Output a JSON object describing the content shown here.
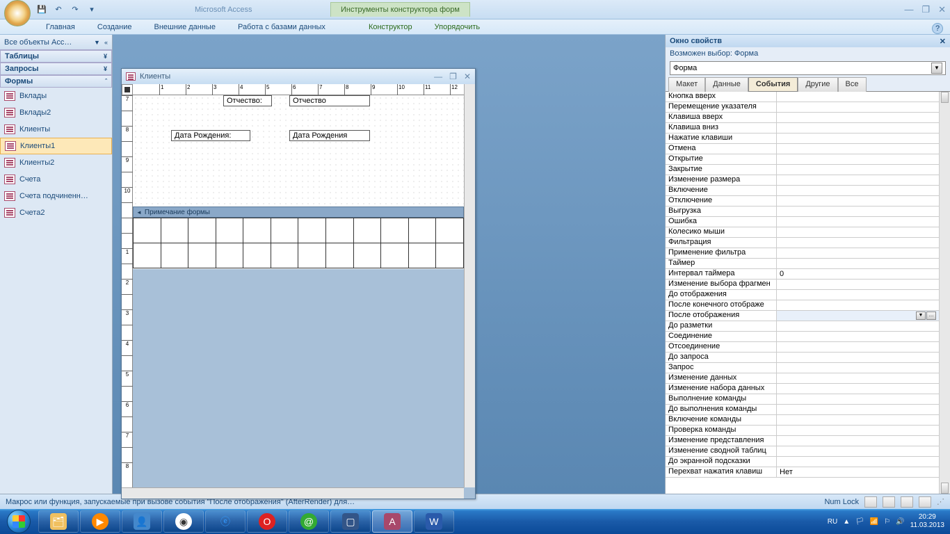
{
  "title": {
    "app": "Microsoft Access",
    "context": "Инструменты конструктора форм"
  },
  "qat": {
    "save": "💾",
    "undo": "↶",
    "redo": "↷"
  },
  "ribbon": {
    "tabs": [
      "Главная",
      "Создание",
      "Внешние данные",
      "Работа с базами данных"
    ],
    "ctx": [
      "Конструктор",
      "Упорядочить"
    ]
  },
  "nav": {
    "header": "Все объекты Acc…",
    "groups": [
      {
        "name": "Таблицы",
        "collapsed": true,
        "items": []
      },
      {
        "name": "Запросы",
        "collapsed": true,
        "items": []
      },
      {
        "name": "Формы",
        "collapsed": false,
        "items": [
          "Вклады",
          "Вклады2",
          "Клиенты",
          "Клиенты1",
          "Клиенты2",
          "Счета",
          "Счета подчиненн…",
          "Счета2"
        ],
        "selected": "Клиенты1"
      }
    ]
  },
  "formwin": {
    "title": "Клиенты",
    "labels": {
      "otch_l": "Отчество:",
      "otch_t": "Отчество",
      "dob_l": "Дата Рождения:",
      "dob_t": "Дата Рождения"
    },
    "footer_section": "Примечание формы"
  },
  "props": {
    "title": "Окно свойств",
    "subtitle": "Возможен выбор:  Форма",
    "object": "Форма",
    "tabs": [
      "Макет",
      "Данные",
      "События",
      "Другие",
      "Все"
    ],
    "active_tab": "События",
    "rows": [
      {
        "n": "Кнопка вверх",
        "v": ""
      },
      {
        "n": "Перемещение указателя",
        "v": ""
      },
      {
        "n": "Клавиша вверх",
        "v": ""
      },
      {
        "n": "Клавиша вниз",
        "v": ""
      },
      {
        "n": "Нажатие клавиши",
        "v": ""
      },
      {
        "n": "Отмена",
        "v": ""
      },
      {
        "n": "Открытие",
        "v": ""
      },
      {
        "n": "Закрытие",
        "v": ""
      },
      {
        "n": "Изменение размера",
        "v": ""
      },
      {
        "n": "Включение",
        "v": ""
      },
      {
        "n": "Отключение",
        "v": ""
      },
      {
        "n": "Выгрузка",
        "v": ""
      },
      {
        "n": "Ошибка",
        "v": ""
      },
      {
        "n": "Колесико мыши",
        "v": ""
      },
      {
        "n": "Фильтрация",
        "v": ""
      },
      {
        "n": "Применение фильтра",
        "v": ""
      },
      {
        "n": "Таймер",
        "v": ""
      },
      {
        "n": "Интервал таймера",
        "v": "0"
      },
      {
        "n": "Изменение выбора фрагмен",
        "v": ""
      },
      {
        "n": "До отображения",
        "v": ""
      },
      {
        "n": "После конечного отображе",
        "v": ""
      },
      {
        "n": "После отображения",
        "v": "",
        "sel": true
      },
      {
        "n": "До разметки",
        "v": ""
      },
      {
        "n": "Соединение",
        "v": ""
      },
      {
        "n": "Отсоединение",
        "v": ""
      },
      {
        "n": "До запроса",
        "v": ""
      },
      {
        "n": "Запрос",
        "v": ""
      },
      {
        "n": "Изменение данных",
        "v": ""
      },
      {
        "n": "Изменение набора данных",
        "v": ""
      },
      {
        "n": "Выполнение команды",
        "v": ""
      },
      {
        "n": "До выполнения команды",
        "v": ""
      },
      {
        "n": "Включение команды",
        "v": ""
      },
      {
        "n": "Проверка команды",
        "v": ""
      },
      {
        "n": "Изменение представления",
        "v": ""
      },
      {
        "n": "Изменение сводной таблиц",
        "v": ""
      },
      {
        "n": "До экранной подсказки",
        "v": ""
      },
      {
        "n": "Перехват нажатия клавиш",
        "v": "Нет"
      }
    ]
  },
  "status": {
    "text": "Макрос или функция, запускаемые при вызове события \"После отображения\" (AfterRender) для…",
    "numlock": "Num Lock"
  },
  "tray": {
    "lang": "RU",
    "time": "20:29",
    "date": "11.03.2013"
  }
}
